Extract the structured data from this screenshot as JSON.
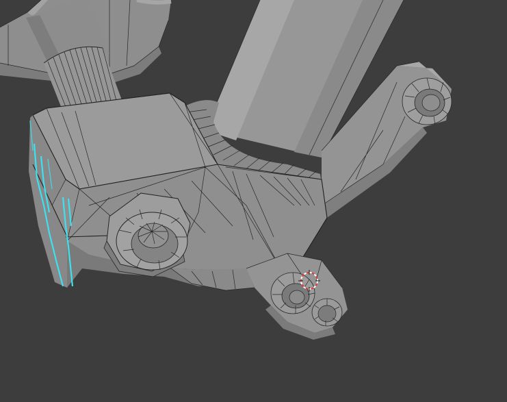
{
  "viewport": {
    "editor": "3d-viewport",
    "mode": "edit",
    "shading": "solid",
    "background_color": "#3d3d3d",
    "mesh_color": "#9c9c9c",
    "wire_color": "#262626",
    "selection_color": "#3fe0ee",
    "cursor_color": "#e03a3a"
  },
  "objects": [
    {
      "name": "clamp-block"
    },
    {
      "name": "tube-upper"
    },
    {
      "name": "tube-left-knurled"
    },
    {
      "name": "bracket-arm"
    },
    {
      "name": "hex-nut"
    },
    {
      "name": "lower-lug"
    }
  ],
  "cursor": {
    "icon": "3d-cursor-icon"
  }
}
